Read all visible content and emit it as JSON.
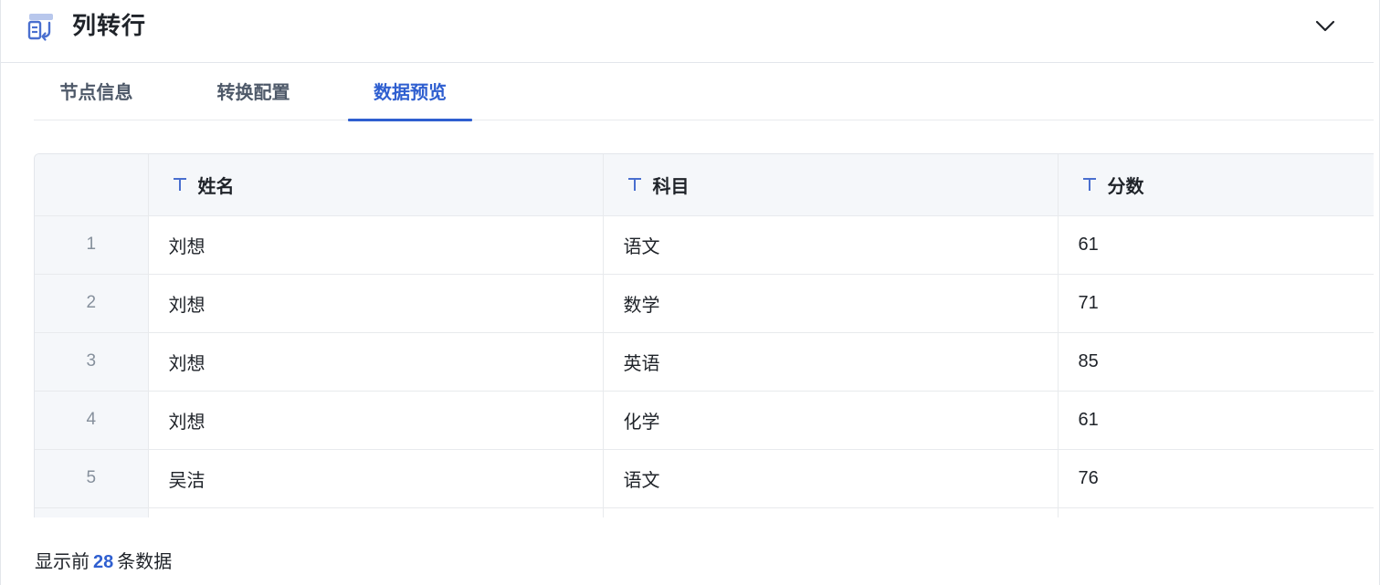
{
  "header": {
    "icon": "column-to-row-icon",
    "title": "列转行",
    "collapse_icon": "chevron-down-icon"
  },
  "tabs": [
    {
      "label": "节点信息",
      "active": false
    },
    {
      "label": "转换配置",
      "active": false
    },
    {
      "label": "数据预览",
      "active": true
    }
  ],
  "table": {
    "columns": [
      {
        "label": "姓名",
        "type_icon": "text-type-icon"
      },
      {
        "label": "科目",
        "type_icon": "text-type-icon"
      },
      {
        "label": "分数",
        "type_icon": "text-type-icon"
      }
    ],
    "rows": [
      {
        "index": "1",
        "cells": [
          "刘想",
          "语文",
          "61"
        ]
      },
      {
        "index": "2",
        "cells": [
          "刘想",
          "数学",
          "71"
        ]
      },
      {
        "index": "3",
        "cells": [
          "刘想",
          "英语",
          "85"
        ]
      },
      {
        "index": "4",
        "cells": [
          "刘想",
          "化学",
          "61"
        ]
      },
      {
        "index": "5",
        "cells": [
          "吴洁",
          "语文",
          "76"
        ]
      },
      {
        "index": "",
        "cells": [
          "",
          "",
          ""
        ]
      }
    ]
  },
  "footer": {
    "prefix": "显示前",
    "count": "28",
    "suffix": "条数据"
  },
  "colors": {
    "accent": "#2f5fd0",
    "header_bg": "#f5f7fa",
    "border": "#e8eaed"
  }
}
